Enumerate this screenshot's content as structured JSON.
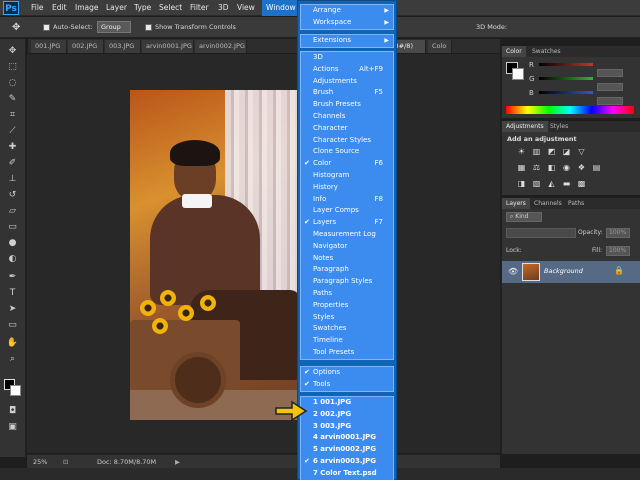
{
  "app": {
    "logo": "Ps"
  },
  "menubar": {
    "items": [
      "File",
      "Edit",
      "Image",
      "Layer",
      "Type",
      "Select",
      "Filter",
      "3D",
      "View",
      "Window"
    ]
  },
  "options": {
    "auto_select": "Auto-Select:",
    "group": "Group",
    "show_transform": "Show Transform Controls",
    "mode3d": "3D Mode:"
  },
  "tabs": [
    "001.JPG",
    "002.JPG",
    "003.JPG",
    "arvin0001.JPG",
    "arvin0002.JPG",
    "(8#/8)",
    "Colo"
  ],
  "statusbar": {
    "zoom": "25%",
    "doc": "Doc: 8.70M/8.70M"
  },
  "panels": {
    "color": {
      "tabs": [
        "Color",
        "Swatches"
      ],
      "channels": [
        "R",
        "G",
        "B"
      ],
      "colors": {
        "r": "#c83232",
        "g": "#32b432",
        "b": "#3258d2"
      }
    },
    "adjustments": {
      "tabs": [
        "Adjustments",
        "Styles"
      ],
      "heading": "Add an adjustment"
    },
    "layers": {
      "tabs": [
        "Layers",
        "Channels",
        "Paths"
      ],
      "kind": "Kind",
      "opacity_label": "Opacity:",
      "opacity_value": "100%",
      "lock_label": "Lock:",
      "fill_label": "Fill:",
      "fill_value": "100%",
      "layer_name": "Background"
    }
  },
  "window_menu": {
    "group1": [
      {
        "label": "Arrange",
        "submenu": true
      },
      {
        "label": "Workspace",
        "submenu": true
      }
    ],
    "group2": [
      {
        "label": "Extensions",
        "submenu": true
      }
    ],
    "group3": [
      {
        "label": "3D",
        "shortcut": "",
        "checked": false
      },
      {
        "label": "Actions",
        "shortcut": "Alt+F9",
        "checked": false
      },
      {
        "label": "Adjustments",
        "shortcut": "",
        "checked": false
      },
      {
        "label": "Brush",
        "shortcut": "F5",
        "checked": false
      },
      {
        "label": "Brush Presets",
        "shortcut": "",
        "checked": false
      },
      {
        "label": "Channels",
        "shortcut": "",
        "checked": false
      },
      {
        "label": "Character",
        "shortcut": "",
        "checked": false
      },
      {
        "label": "Character Styles",
        "shortcut": "",
        "checked": false
      },
      {
        "label": "Clone Source",
        "shortcut": "",
        "checked": false
      },
      {
        "label": "Color",
        "shortcut": "F6",
        "checked": true
      },
      {
        "label": "Histogram",
        "shortcut": "",
        "checked": false
      },
      {
        "label": "History",
        "shortcut": "",
        "checked": false
      },
      {
        "label": "Info",
        "shortcut": "F8",
        "checked": false
      },
      {
        "label": "Layer Comps",
        "shortcut": "",
        "checked": false
      },
      {
        "label": "Layers",
        "shortcut": "F7",
        "checked": true
      },
      {
        "label": "Measurement Log",
        "shortcut": "",
        "checked": false
      },
      {
        "label": "Navigator",
        "shortcut": "",
        "checked": false
      },
      {
        "label": "Notes",
        "shortcut": "",
        "checked": false
      },
      {
        "label": "Paragraph",
        "shortcut": "",
        "checked": false
      },
      {
        "label": "Paragraph Styles",
        "shortcut": "",
        "checked": false
      },
      {
        "label": "Paths",
        "shortcut": "",
        "checked": false
      },
      {
        "label": "Properties",
        "shortcut": "",
        "checked": false
      },
      {
        "label": "Styles",
        "shortcut": "",
        "checked": false
      },
      {
        "label": "Swatches",
        "shortcut": "",
        "checked": false
      },
      {
        "label": "Timeline",
        "shortcut": "",
        "checked": false
      },
      {
        "label": "Tool Presets",
        "shortcut": "",
        "checked": false
      }
    ],
    "group4": [
      {
        "label": "Options",
        "checked": true
      },
      {
        "label": "Tools",
        "checked": true
      }
    ],
    "group5": [
      {
        "label": "1 001.JPG",
        "checked": false
      },
      {
        "label": "2 002.JPG",
        "checked": false
      },
      {
        "label": "3 003.JPG",
        "checked": false
      },
      {
        "label": "4 arvin0001.JPG",
        "checked": false
      },
      {
        "label": "5 arvin0002.JPG",
        "checked": false
      },
      {
        "label": "6 arvin0003.JPG",
        "checked": true
      },
      {
        "label": "7 Color Text.psd",
        "checked": false
      }
    ]
  },
  "colors": {
    "menu_bg": "#3c8cf0",
    "menu_active": "#1d71c9",
    "arrow": "#f5c400"
  }
}
